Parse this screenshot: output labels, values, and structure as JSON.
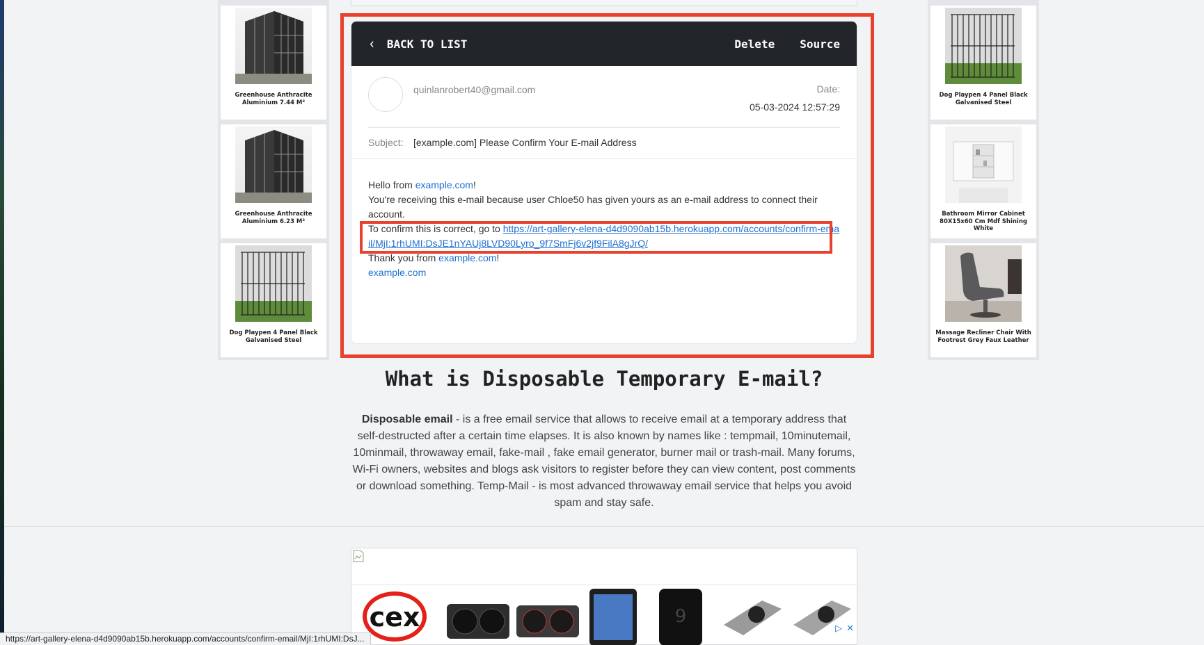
{
  "left_products": [
    {
      "name": "Greenhouse Anthracite Aluminium 7.44 M³",
      "kind": "greenhouse"
    },
    {
      "name": "Greenhouse Anthracite Aluminium 6.23 M³",
      "kind": "greenhouse"
    },
    {
      "name": "Dog Playpen 4 Panel Black Galvanised Steel",
      "kind": "playpen"
    }
  ],
  "right_products": [
    {
      "name": "Dog Playpen 4 Panel Black Galvanised Steel",
      "kind": "playpen"
    },
    {
      "name": "Bathroom Mirror Cabinet 80X15x60 Cm Mdf Shining White",
      "kind": "mirror"
    },
    {
      "name": "Massage Recliner Chair With Footrest Grey Faux Leather",
      "kind": "chair"
    }
  ],
  "email": {
    "toolbar": {
      "back_label": "BACK TO LIST",
      "delete_label": "Delete",
      "source_label": "Source"
    },
    "from": "quinlanrobert40@gmail.com",
    "date_label": "Date:",
    "date_value": "05-03-2024 12:57:29",
    "subject_label": "Subject:",
    "subject_value": "[example.com] Please Confirm Your E-mail Address",
    "body": {
      "hello_prefix": "Hello from ",
      "hello_link": "example.com",
      "hello_suffix": "!",
      "receiving_text": "You're receiving this e-mail because user Chloe50 has given yours as an e-mail address to connect their account.",
      "confirm_prefix": "To confirm this is correct, go to ",
      "confirm_link": "https://art-gallery-elena-d4d9090ab15b.herokuapp.com/accounts/confirm-email/MjI:1rhUMI:DsJE1nYAUj8LVD90Lyro_9f7SmFj6v2jf9FilA8gJrQ/",
      "thanks_prefix": "Thank you from ",
      "thanks_link": "example.com",
      "thanks_suffix": "!",
      "signature_link": "example.com"
    }
  },
  "about": {
    "title": "What is Disposable Temporary E-mail?",
    "bold_lead": "Disposable email",
    "text": " - is a free email service that allows to receive email at a temporary address that self-destructed after a certain time elapses. It is also known by names like : tempmail, 10minutemail, 10minmail, throwaway email, fake-mail , fake email generator, burner mail or trash-mail. Many forums, Wi-Fi owners, websites and blogs ask visitors to register before they can view content, post comments or download something. Temp-Mail - is most advanced throwaway email service that helps you avoid spam and stay safe."
  },
  "ad": {
    "brand_logo": "cex"
  },
  "status_bar": {
    "url": "https://art-gallery-elena-d4d9090ab15b.herokuapp.com/accounts/confirm-email/MjI:1rhUMI:DsJ..."
  },
  "colors": {
    "highlight": "#e8412d",
    "link": "#1f6fd1",
    "toolbar_bg": "#22252a"
  }
}
